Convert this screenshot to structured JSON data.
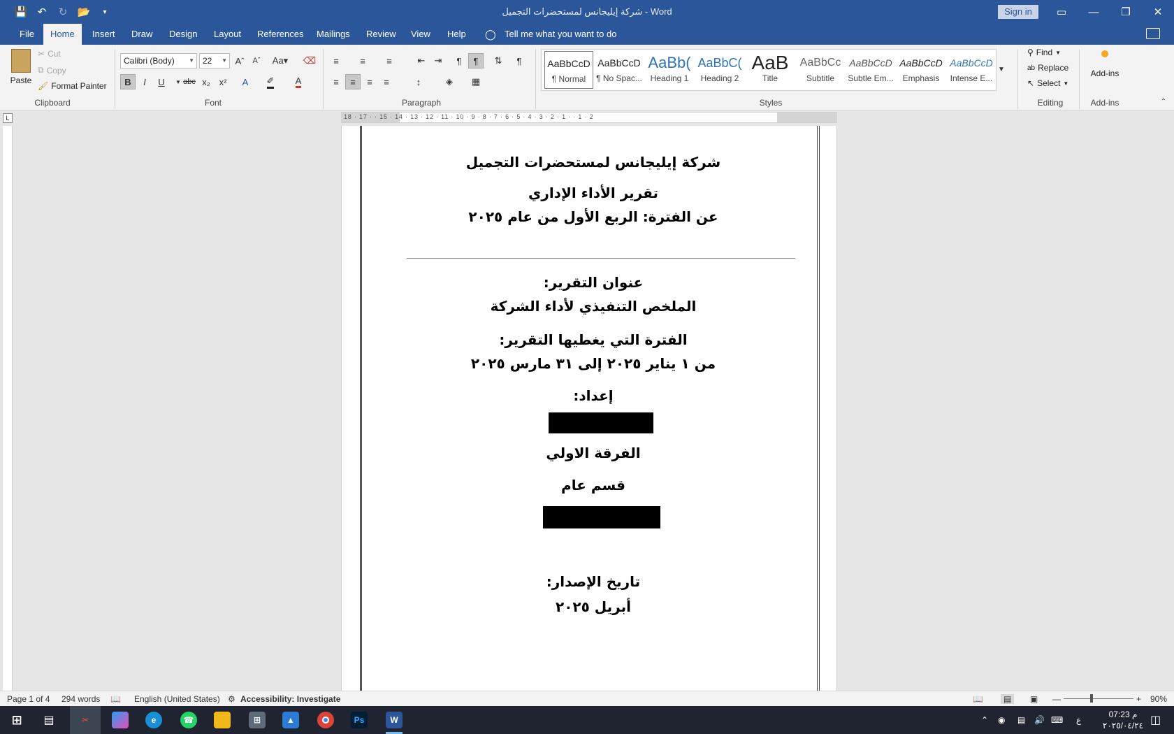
{
  "titlebar": {
    "title": "شركة إيليجانس لمستحضرات التجميل  -  Word",
    "sign_in": "Sign in",
    "qat_icons": [
      "save-icon",
      "undo-icon",
      "redo-icon",
      "open-icon",
      "customize-icon"
    ]
  },
  "tabs": [
    "File",
    "Home",
    "Insert",
    "Draw",
    "Design",
    "Layout",
    "References",
    "Mailings",
    "Review",
    "View",
    "Help"
  ],
  "active_tab": "Home",
  "tell_me": "Tell me what you want to do",
  "ribbon": {
    "clipboard": {
      "label": "Clipboard",
      "paste": "Paste",
      "cut": "Cut",
      "copy": "Copy",
      "format_painter": "Format Painter"
    },
    "font": {
      "label": "Font",
      "font_name": "Calibri (Body)",
      "font_size": "22"
    },
    "paragraph": {
      "label": "Paragraph"
    },
    "styles": {
      "label": "Styles",
      "items": [
        {
          "preview": "AaBbCcD",
          "name": "¶ Normal"
        },
        {
          "preview": "AaBbCcD",
          "name": "¶ No Spac..."
        },
        {
          "preview": "AaBb(",
          "name": "Heading 1"
        },
        {
          "preview": "AaBbC(",
          "name": "Heading 2"
        },
        {
          "preview": "AaB",
          "name": "Title"
        },
        {
          "preview": "AaBbCc",
          "name": "Subtitle"
        },
        {
          "preview": "AaBbCcD",
          "name": "Subtle Em..."
        },
        {
          "preview": "AaBbCcD",
          "name": "Emphasis"
        },
        {
          "preview": "AaBbCcD",
          "name": "Intense E..."
        }
      ]
    },
    "editing": {
      "label": "Editing",
      "find": "Find",
      "replace": "Replace",
      "select": "Select"
    },
    "addins": {
      "label": "Add-ins",
      "button": "Add-ins"
    }
  },
  "ruler_marks": "18 · 17 · · 15 · 14 · 13 · 12 · 11 · 10 · 9 · 8 · 7 · 6 · 5 · 4 · 3 · 2 · 1 · · 1 · 2",
  "document": {
    "company": "شركة إيليجانس لمستحضرات التجميل",
    "report_title": "تقرير الأداء الإداري",
    "period_line": "عن الفترة: الربع الأول من عام ٢٠٢٥",
    "subject_label": "عنوان التقرير:",
    "subject": "الملخص التنفيذي لأداء الشركة",
    "coverage_label": "الفترة التي يغطيها التقرير:",
    "coverage": "من ١ يناير ٢٠٢٥ إلى ٣١ مارس ٢٠٢٥",
    "prepared_label": "إعداد:",
    "year_level": "الفرقة الاولي",
    "department": "قسم عام",
    "issue_label": "تاريخ الإصدار:",
    "issue_date": "أبريل ٢٠٢٥"
  },
  "statusbar": {
    "page": "Page 1 of 4",
    "words": "294 words",
    "language": "English (United States)",
    "accessibility": "Accessibility: Investigate",
    "zoom": "90%"
  },
  "taskbar": {
    "time": "07:23 م",
    "date": "٢٠٢٥/٠٤/٢٤",
    "lang": "ع"
  }
}
